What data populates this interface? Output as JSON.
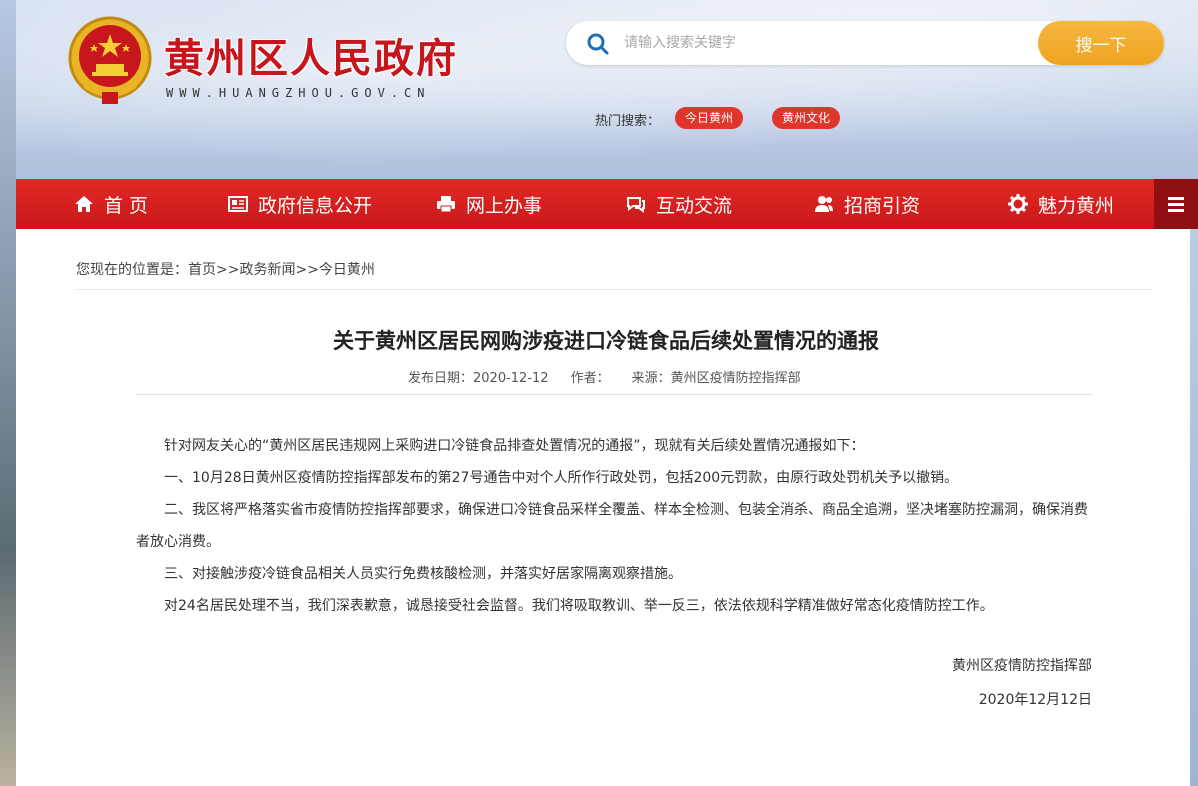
{
  "site": {
    "title": "黄州区人民政府",
    "url": "WWW.HUANGZHOU.GOV.CN"
  },
  "search": {
    "placeholder": "请输入搜索关键字",
    "button_label": "搜一下",
    "hot_label": "热门搜索：",
    "hot_tags": [
      "今日黄州",
      "黄州文化"
    ]
  },
  "nav": {
    "items": [
      {
        "label": "首 页",
        "icon": "home-icon"
      },
      {
        "label": "政府信息公开",
        "icon": "document-icon"
      },
      {
        "label": "网上办事",
        "icon": "printer-icon"
      },
      {
        "label": "互动交流",
        "icon": "chat-icon"
      },
      {
        "label": "招商引资",
        "icon": "users-icon"
      },
      {
        "label": "魅力黄州",
        "icon": "gear-icon"
      }
    ],
    "more_icon": "menu-icon"
  },
  "breadcrumb": {
    "prefix": "您现在的位置是：",
    "path": "首页>>政务新闻>>今日黄州"
  },
  "article": {
    "title": "关于黄州区居民网购涉疫进口冷链食品后续处置情况的通报",
    "date_label": "发布日期：",
    "date": "2020-12-12",
    "author_label": "作者：",
    "source_label": "来源：",
    "source": "黄州区疫情防控指挥部",
    "paragraphs": [
      "针对网友关心的“黄州区居民违规网上采购进口冷链食品排查处置情况的通报”，现就有关后续处置情况通报如下：",
      "一、10月28日黄州区疫情防控指挥部发布的第27号通告中对个人所作行政处罚，包括200元罚款，由原行政处罚机关予以撤销。",
      "二、我区将严格落实省市疫情防控指挥部要求，确保进口冷链食品采样全覆盖、样本全检测、包装全消杀、商品全追溯，坚决堵塞防控漏洞，确保消费者放心消费。",
      "三、对接触涉疫冷链食品相关人员实行免费核酸检测，并落实好居家隔离观察措施。",
      "对24名居民处理不当，我们深表歉意，诚恳接受社会监督。我们将吸取教训、举一反三，依法依规科学精准做好常态化疫情防控工作。"
    ],
    "signer": "黄州区疫情防控指挥部",
    "sign_date": "2020年12月12日"
  },
  "colors": {
    "brand_red": "#c4161c",
    "nav_red": "#d81e1e",
    "search_orange": "#f0a321",
    "tag_red": "#e0352b"
  }
}
